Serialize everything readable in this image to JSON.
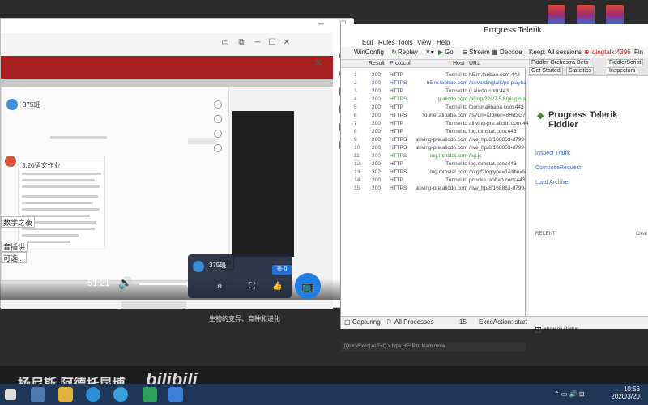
{
  "player": {
    "chat_group_name": "375班",
    "chat_msg_title": "3.20语文作业",
    "left_tag_1": "数学之夜",
    "left_tag_2": "音插讲",
    "left_tag_3": "可选...",
    "zhong_label": "中",
    "time_display": "51:21",
    "live_card_title": "375班",
    "live_badge_label": "签 0",
    "bottom_caption": "生物的变异、育种和进化",
    "volume_percent": 94
  },
  "fiddler": {
    "title": "Progress Telerik",
    "menu": [
      "Edit",
      "Rules",
      "Tools",
      "View",
      "Help"
    ],
    "toolbar": {
      "winconfig": "WinConfig",
      "replay": "Replay",
      "go": "Go",
      "stream": "Stream",
      "decode": "Decode",
      "keep": "Keep: All sessions",
      "process": "dingtalk:4396",
      "find": "Fin"
    },
    "columns": [
      "Result",
      "Protocol",
      "Host",
      "URL"
    ],
    "rows": [
      {
        "id": "1",
        "result": "200",
        "protocol": "HTTP",
        "host": "Tunnel to",
        "url": "h5.m.taobao.com:443",
        "color": "#444"
      },
      {
        "id": "2",
        "result": "200",
        "protocol": "HTTPS",
        "host": "h5.m.taobao.com",
        "url": "/bilive/dingtalk/pc-playba",
        "color": "#2b5bd6"
      },
      {
        "id": "3",
        "result": "200",
        "protocol": "HTTP",
        "host": "Tunnel to",
        "url": "g.alicdn.com:443",
        "color": "#444"
      },
      {
        "id": "4",
        "result": "200",
        "protocol": "HTTPS",
        "host": "g.alicdn.com",
        "url": "/alilog/??s/7.5.8/plugin/a",
        "color": "#2aa02a"
      },
      {
        "id": "5",
        "result": "200",
        "protocol": "HTTP",
        "host": "Tunnel to",
        "url": "fourier.alibaba.com:443",
        "color": "#444"
      },
      {
        "id": "6",
        "result": "200",
        "protocol": "HTTPS",
        "host": "fourier.alibaba.com",
        "url": "/ts?url=&token=8Hd3G7",
        "color": "#444"
      },
      {
        "id": "7",
        "result": "200",
        "protocol": "HTTP",
        "host": "Tunnel to",
        "url": "alliving-pre.alicdn.com:443",
        "color": "#444"
      },
      {
        "id": "8",
        "result": "200",
        "protocol": "HTTP",
        "host": "Tunnel to",
        "url": "log.mmstat.com:443",
        "color": "#444"
      },
      {
        "id": "9",
        "result": "200",
        "protocol": "HTTPS",
        "host": "alliving-pre.alicdn.com",
        "url": "/live_hp/8f168863-d799-",
        "color": "#444"
      },
      {
        "id": "10",
        "result": "200",
        "protocol": "HTTPS",
        "host": "alliving-pre.alicdn.com",
        "url": "/live_hp/8f168863-d799-",
        "color": "#444"
      },
      {
        "id": "11",
        "result": "200",
        "protocol": "HTTPS",
        "host": "log.mmstat.com",
        "url": "/eg.js",
        "color": "#2aa02a"
      },
      {
        "id": "12",
        "result": "200",
        "protocol": "HTTP",
        "host": "Tunnel to",
        "url": "log.mmstat.com:443",
        "color": "#444"
      },
      {
        "id": "13",
        "result": "302",
        "protocol": "HTTPS",
        "host": "log.mmstat.com",
        "url": "/m.gif?logtype=1&title=N",
        "color": "#444"
      },
      {
        "id": "14",
        "result": "200",
        "protocol": "HTTP",
        "host": "Tunnel to",
        "url": "pcpoke.taobao.com:443",
        "color": "#444"
      },
      {
        "id": "15",
        "result": "200",
        "protocol": "HTTPS",
        "host": "alliving-pre.alicdn.com",
        "url": "/live_hp/8f168863-d799-",
        "color": "#444"
      }
    ],
    "tabs_row1": [
      "Fiddler Orchestra Beta",
      "FiddlerScript"
    ],
    "tabs_row2": [
      "Get Started",
      "Statistics",
      "Inspectors"
    ],
    "logo": "Progress Telerik Fiddler",
    "links": [
      "Inspect Traffic",
      "ComposeRequest",
      "Load Archive"
    ],
    "recent_label": "RECENT",
    "clear_label": "Clear",
    "show_on_startup": "Show on startup",
    "quickexec": "[QuickExec] ALT+Q > type HELP to learn more",
    "status": {
      "capturing": "Capturing",
      "all_processes": "All Processes",
      "count": "15",
      "exec_action": "ExecAction: start"
    }
  },
  "watermark": "扬尼斯 阿德托昆博",
  "bilibili": "bilibili",
  "clock": {
    "time": "10:56",
    "date": "2020/3/20"
  }
}
